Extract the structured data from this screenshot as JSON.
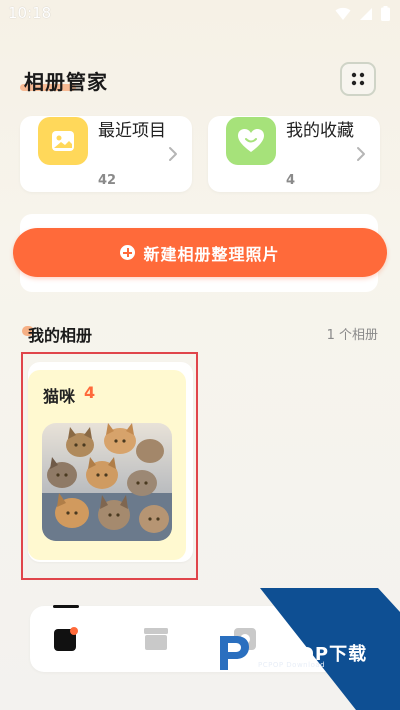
{
  "status_bar": {
    "time": "10:18",
    "icons": [
      "wifi-icon",
      "signal-icon",
      "battery-icon"
    ]
  },
  "header": {
    "title": "相册管家",
    "menu_icon": "grid-dots-icon"
  },
  "quick_cards": [
    {
      "label": "最近项目",
      "count": "42",
      "icon": "image-icon",
      "color": "#ffd85a"
    },
    {
      "label": "我的收藏",
      "count": "4",
      "icon": "heart-icon",
      "color": "#a6e27a"
    }
  ],
  "create_button": {
    "label": "新建相册整理照片",
    "color": "#ff6a3a"
  },
  "albums_section": {
    "title": "我的相册",
    "count_text": "1 个相册",
    "albums": [
      {
        "name": "猫咪",
        "count": "4",
        "thumbnail": "cats-photo"
      }
    ]
  },
  "bottom_nav": {
    "items": [
      {
        "icon": "albums-icon",
        "active": true
      },
      {
        "icon": "box-icon",
        "active": false
      },
      {
        "icon": "settings-icon",
        "active": false
      }
    ]
  },
  "watermark": {
    "text": "PCPOP下载",
    "subtext": "PCPOP Download"
  }
}
